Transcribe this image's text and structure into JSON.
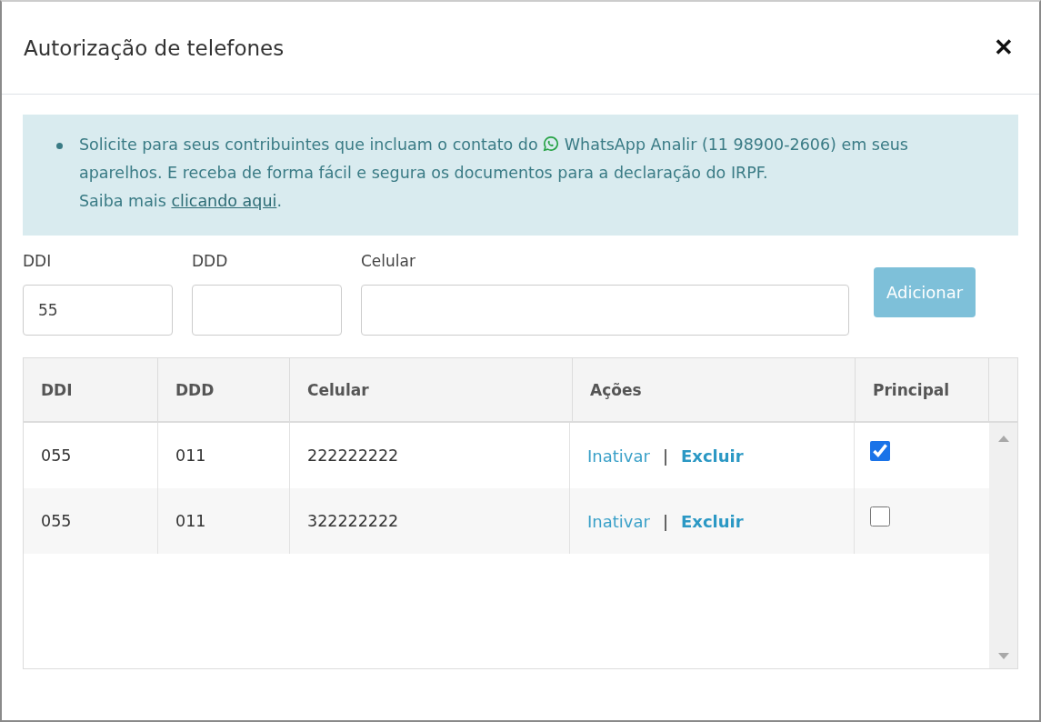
{
  "dialog": {
    "title": "Autorização de telefones",
    "close": "✕"
  },
  "notice": {
    "text_before": "Solicite para seus contribuintes que incluam o contato do",
    "text_after": "WhatsApp Analir (11 98900-2606) em seus aparelhos. E receba de forma fácil e segura os documentos para a declaração do IRPF.",
    "more_prefix": "Saiba mais",
    "link": "clicando aqui",
    "more_suffix": "."
  },
  "form": {
    "fields": [
      {
        "label": "DDI",
        "value": "55"
      },
      {
        "label": "DDD"
      },
      {
        "label": "Celular"
      }
    ],
    "button": "Adicionar"
  },
  "table": {
    "columns": [
      "DDI",
      "DDD",
      "Celular",
      "Ações",
      "Principal"
    ],
    "rows": [
      {
        "ddi": "055",
        "ddd": "011",
        "celular": "222222222",
        "actions": [
          "Inativar",
          "|",
          "Excluir"
        ],
        "principal": true
      },
      {
        "ddi": "055",
        "ddd": "011",
        "celular": "322222222",
        "actions": [
          "Inativar",
          "|",
          "Excluir"
        ],
        "principal": false
      }
    ]
  }
}
